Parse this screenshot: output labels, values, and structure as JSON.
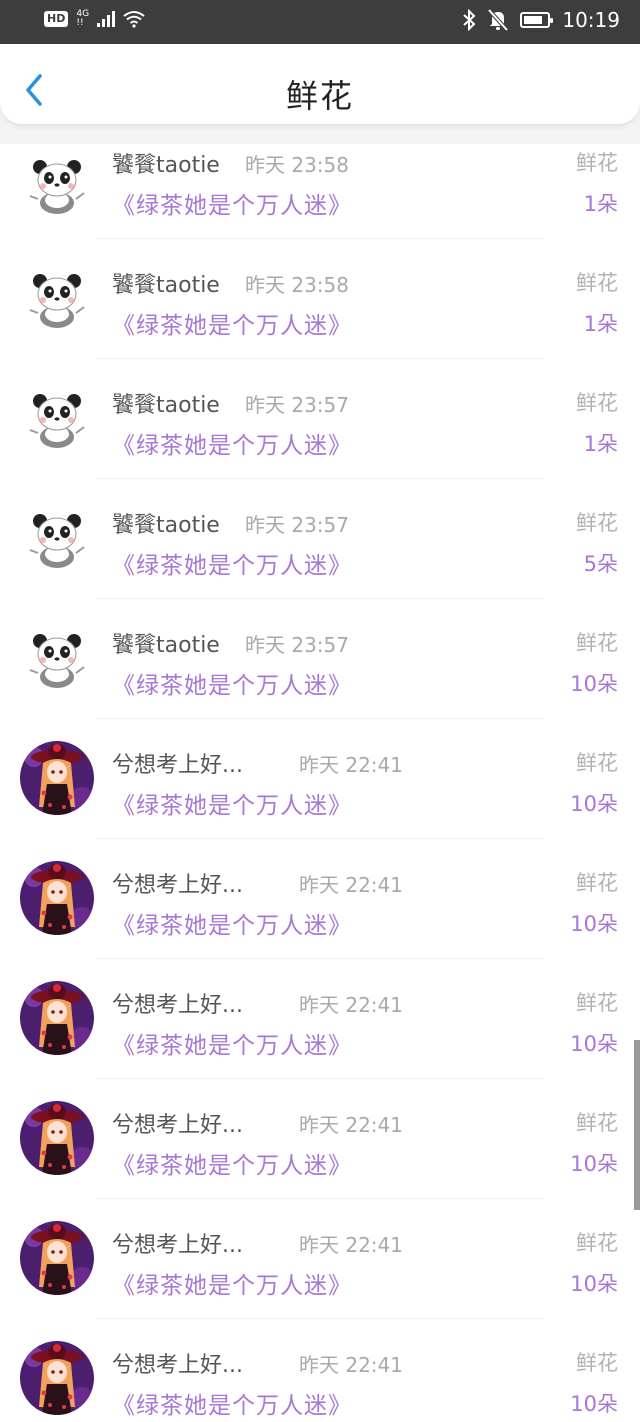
{
  "status_bar": {
    "hd": "HD",
    "network": "4G",
    "network_sub": "!!",
    "time": "10:19",
    "icons": [
      "signal-icon",
      "wifi-icon",
      "bluetooth-icon",
      "mute-bell-icon",
      "battery-icon"
    ]
  },
  "header": {
    "title": "鲜花",
    "back_icon": "chevron-left-icon",
    "accent": "#2b8fe0"
  },
  "colors": {
    "book": "#a776d6",
    "muted": "#b2b2b2"
  },
  "rows": [
    {
      "user": "饕餮taotie",
      "time": "昨天 23:58",
      "book": "《绿茶她是个万人迷》",
      "type": "鲜花",
      "count": "1朵",
      "avatar": "panda-avatar"
    },
    {
      "user": "饕餮taotie",
      "time": "昨天 23:58",
      "book": "《绿茶她是个万人迷》",
      "type": "鲜花",
      "count": "1朵",
      "avatar": "panda-avatar"
    },
    {
      "user": "饕餮taotie",
      "time": "昨天 23:57",
      "book": "《绿茶她是个万人迷》",
      "type": "鲜花",
      "count": "1朵",
      "avatar": "panda-avatar"
    },
    {
      "user": "饕餮taotie",
      "time": "昨天 23:57",
      "book": "《绿茶她是个万人迷》",
      "type": "鲜花",
      "count": "5朵",
      "avatar": "panda-avatar"
    },
    {
      "user": "饕餮taotie",
      "time": "昨天 23:57",
      "book": "《绿茶她是个万人迷》",
      "type": "鲜花",
      "count": "10朵",
      "avatar": "panda-avatar"
    },
    {
      "user": "兮想考上好...",
      "time": "昨天 22:41",
      "book": "《绿茶她是个万人迷》",
      "type": "鲜花",
      "count": "10朵",
      "avatar": "anime-girl-avatar"
    },
    {
      "user": "兮想考上好...",
      "time": "昨天 22:41",
      "book": "《绿茶她是个万人迷》",
      "type": "鲜花",
      "count": "10朵",
      "avatar": "anime-girl-avatar"
    },
    {
      "user": "兮想考上好...",
      "time": "昨天 22:41",
      "book": "《绿茶她是个万人迷》",
      "type": "鲜花",
      "count": "10朵",
      "avatar": "anime-girl-avatar"
    },
    {
      "user": "兮想考上好...",
      "time": "昨天 22:41",
      "book": "《绿茶她是个万人迷》",
      "type": "鲜花",
      "count": "10朵",
      "avatar": "anime-girl-avatar"
    },
    {
      "user": "兮想考上好...",
      "time": "昨天 22:41",
      "book": "《绿茶她是个万人迷》",
      "type": "鲜花",
      "count": "10朵",
      "avatar": "anime-girl-avatar"
    },
    {
      "user": "兮想考上好...",
      "time": "昨天 22:41",
      "book": "《绿茶她是个万人迷》",
      "type": "鲜花",
      "count": "10朵",
      "avatar": "anime-girl-avatar"
    }
  ]
}
